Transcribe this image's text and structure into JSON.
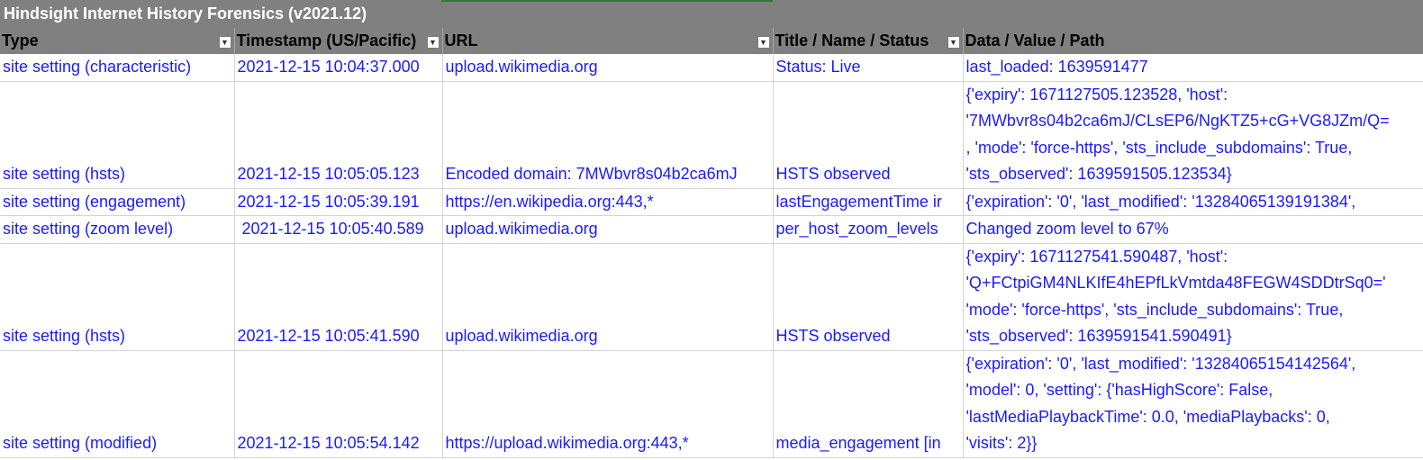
{
  "sheet": {
    "title": "Hindsight Internet History Forensics (v2021.12)"
  },
  "columns": [
    {
      "label": "Type",
      "filter_icon": "filter-active-icon"
    },
    {
      "label": "Timestamp (US/Pacific)",
      "filter_icon": "dropdown-icon"
    },
    {
      "label": "URL",
      "filter_icon": "dropdown-icon"
    },
    {
      "label": "Title / Name / Status",
      "filter_icon": "dropdown-icon"
    },
    {
      "label": "Data / Value / Path",
      "filter_icon": ""
    }
  ],
  "rows": [
    {
      "type": "site setting (characteristic)",
      "timestamp": "2021-12-15 10:04:37.000",
      "url": "upload.wikimedia.org",
      "title": "Status: Live",
      "data": "last_loaded: 1639591477"
    },
    {
      "type": "site setting (hsts)",
      "timestamp": "2021-12-15 10:05:05.123",
      "url": "Encoded domain: 7MWbvr8s04b2ca6mJ",
      "title": "HSTS observed",
      "data": "{'expiry': 1671127505.123528, 'host':\n'7MWbvr8s04b2ca6mJ/CLsEP6/NgKTZ5+cG+VG8JZm/Q=\n, 'mode': 'force-https', 'sts_include_subdomains': True,\n'sts_observed': 1639591505.123534}"
    },
    {
      "type": "site setting (engagement)",
      "timestamp": "2021-12-15 10:05:39.191",
      "url": "https://en.wikipedia.org:443,*",
      "title": "lastEngagementTime ir",
      "data": "{'expiration': '0', 'last_modified': '13284065139191384',"
    },
    {
      "type": "site setting (zoom level)",
      "timestamp": " 2021-12-15 10:05:40.589",
      "url": "upload.wikimedia.org",
      "title": "per_host_zoom_levels",
      "data": "Changed zoom level to 67%"
    },
    {
      "type": "site setting (hsts)",
      "timestamp": "2021-12-15 10:05:41.590",
      "url": "upload.wikimedia.org",
      "title": "HSTS observed",
      "data": "{'expiry': 1671127541.590487, 'host':\n'Q+FCtpiGM4NLKIfE4hEPfLkVmtda48FEGW4SDDtrSq0='\n'mode': 'force-https', 'sts_include_subdomains': True,\n'sts_observed': 1639591541.590491}"
    },
    {
      "type": "site setting (modified)",
      "timestamp": "2021-12-15 10:05:54.142",
      "url": "https://upload.wikimedia.org:443,*",
      "title": "media_engagement [in",
      "data": "{'expiration': '0', 'last_modified': '13284065154142564',\n'model': 0, 'setting': {'hasHighScore': False,\n'lastMediaPlaybackTime': 0.0, 'mediaPlaybacks': 0,\n'visits': 2}}"
    }
  ],
  "colors": {
    "header_bg": "#808080",
    "link_text": "#1a1aff",
    "title_text": "#ffffff"
  }
}
